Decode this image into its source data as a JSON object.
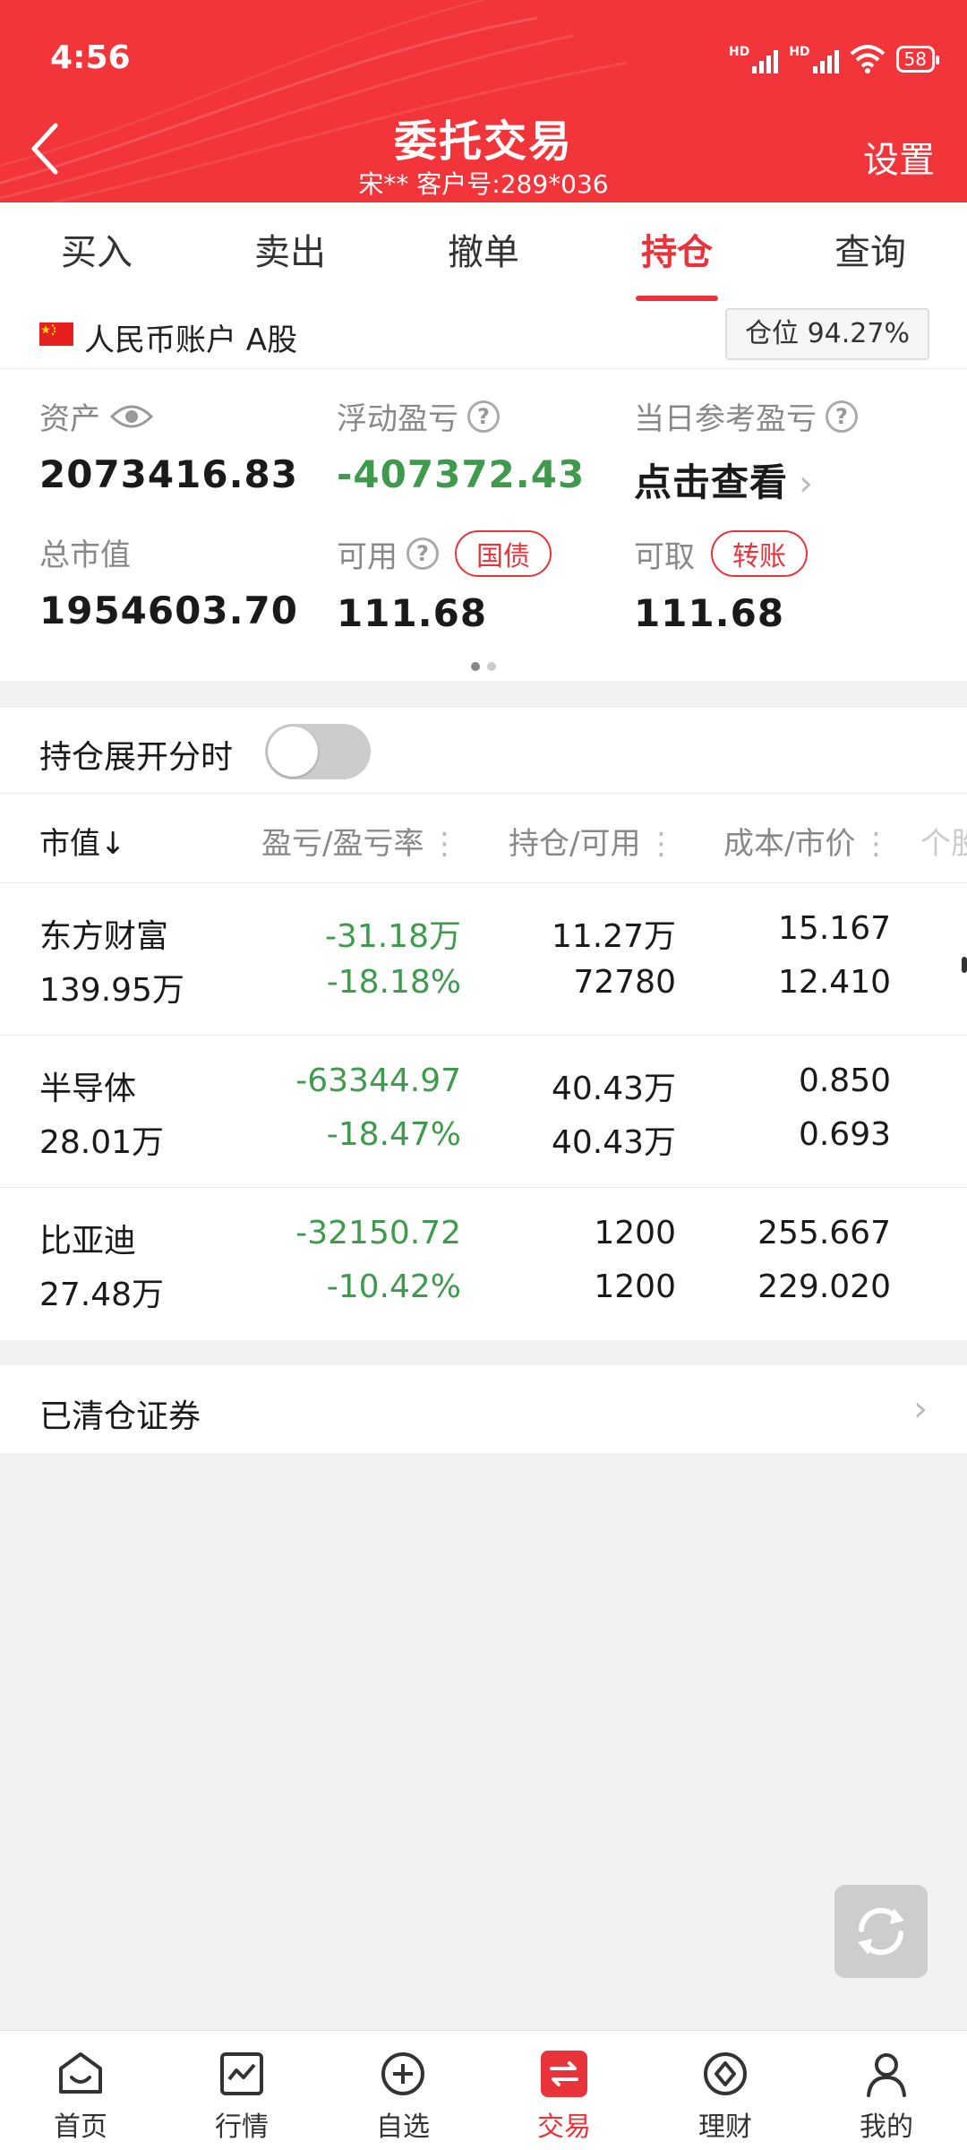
{
  "status_bar": {
    "time": "4:56",
    "battery": "58",
    "hd1": "HD",
    "hd2": "HD"
  },
  "header": {
    "title": "委托交易",
    "subtitle": "宋**  客户号:289*036",
    "settings_label": "设置"
  },
  "tabs": [
    {
      "label": "买入"
    },
    {
      "label": "卖出"
    },
    {
      "label": "撤单"
    },
    {
      "label": "持仓",
      "active": true
    },
    {
      "label": "查询"
    }
  ],
  "account": {
    "label": "人民币账户 A股",
    "position": "仓位 94.27%"
  },
  "assets": {
    "assets_label": "资产",
    "assets_value": "2073416.83",
    "float_pl_label": "浮动盈亏",
    "float_pl_value": "-407372.43",
    "daily_pl_label": "当日参考盈亏",
    "daily_pl_value": "点击查看",
    "market_value_label": "总市值",
    "market_value": "1954603.70",
    "available_label": "可用",
    "available_value": "111.68",
    "bond_button": "国债",
    "withdrawable_label": "可取",
    "withdrawable_value": "111.68",
    "transfer_button": "转账"
  },
  "toggle": {
    "label": "持仓展开分时",
    "on": false
  },
  "table": {
    "headers": [
      "市值↓",
      "盈亏/盈亏率",
      "持仓/可用",
      "成本/市价",
      "个股"
    ],
    "rows": [
      {
        "name": "东方财富",
        "market_value": "139.95万",
        "pl": "-31.18万",
        "pl_rate": "-18.18%",
        "holding": "11.27万",
        "available": "72780",
        "cost": "15.167",
        "price": "12.410"
      },
      {
        "name": "半导体",
        "market_value": "28.01万",
        "pl": "-63344.97",
        "pl_rate": "-18.47%",
        "holding": "40.43万",
        "available": "40.43万",
        "cost": "0.850",
        "price": "0.693"
      },
      {
        "name": "比亚迪",
        "market_value": "27.48万",
        "pl": "-32150.72",
        "pl_rate": "-10.42%",
        "holding": "1200",
        "available": "1200",
        "cost": "255.667",
        "price": "229.020"
      }
    ]
  },
  "cleared": {
    "label": "已清仓证券"
  },
  "bottom_nav": [
    {
      "label": "首页",
      "icon": "home-icon"
    },
    {
      "label": "行情",
      "icon": "chart-icon"
    },
    {
      "label": "自选",
      "icon": "add-circle-icon"
    },
    {
      "label": "交易",
      "icon": "trade-icon",
      "active": true
    },
    {
      "label": "理财",
      "icon": "finance-icon"
    },
    {
      "label": "我的",
      "icon": "user-icon"
    }
  ],
  "colors": {
    "brand_red": "#f2353a",
    "loss_green": "#3f9a4e"
  }
}
